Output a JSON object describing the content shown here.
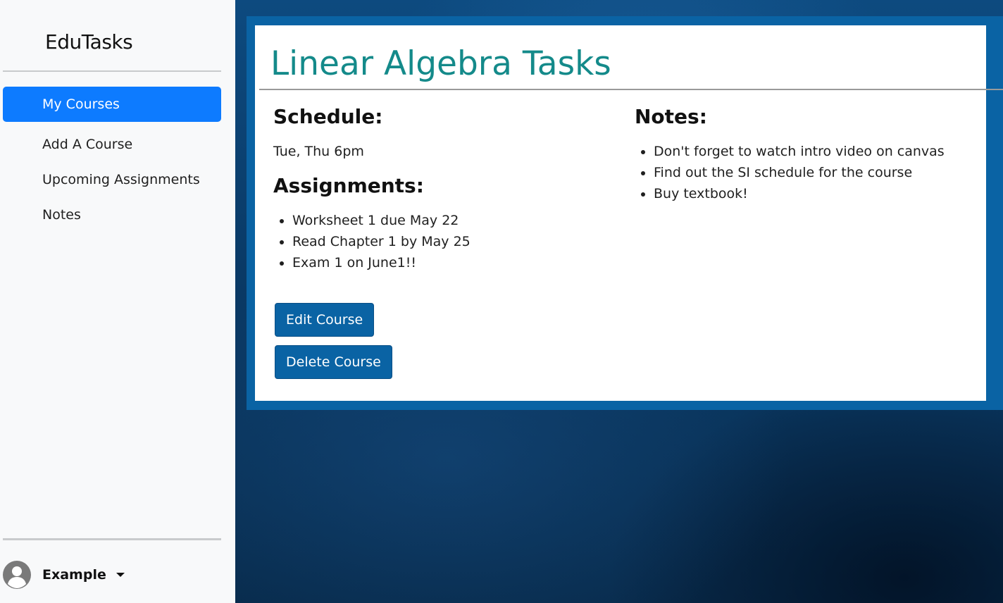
{
  "app": {
    "brand": "EduTasks"
  },
  "sidebar": {
    "items": [
      {
        "label": "My Courses",
        "active": true
      },
      {
        "label": "Add A Course",
        "active": false
      },
      {
        "label": "Upcoming Assignments",
        "active": false
      },
      {
        "label": "Notes",
        "active": false
      }
    ],
    "user": {
      "name": "Example",
      "avatar_icon": "user-avatar-icon",
      "menu_icon": "caret-down-icon"
    }
  },
  "course": {
    "title": "Linear Algebra Tasks",
    "schedule_heading": "Schedule:",
    "schedule": "Tue, Thu 6pm",
    "assignments_heading": "Assignments:",
    "assignments": [
      "Worksheet 1 due May 22",
      "Read Chapter 1 by May 25",
      "Exam 1 on June1!!"
    ],
    "notes_heading": "Notes:",
    "notes": [
      "Don't forget to watch intro video on canvas",
      "Find out the SI schedule for the course",
      "Buy textbook!"
    ],
    "edit_label": "Edit Course",
    "delete_label": "Delete Course"
  },
  "colors": {
    "accent": "#0d7bff",
    "card_border": "#0a63a4",
    "title": "#148a8a",
    "button": "#0a63a4"
  }
}
